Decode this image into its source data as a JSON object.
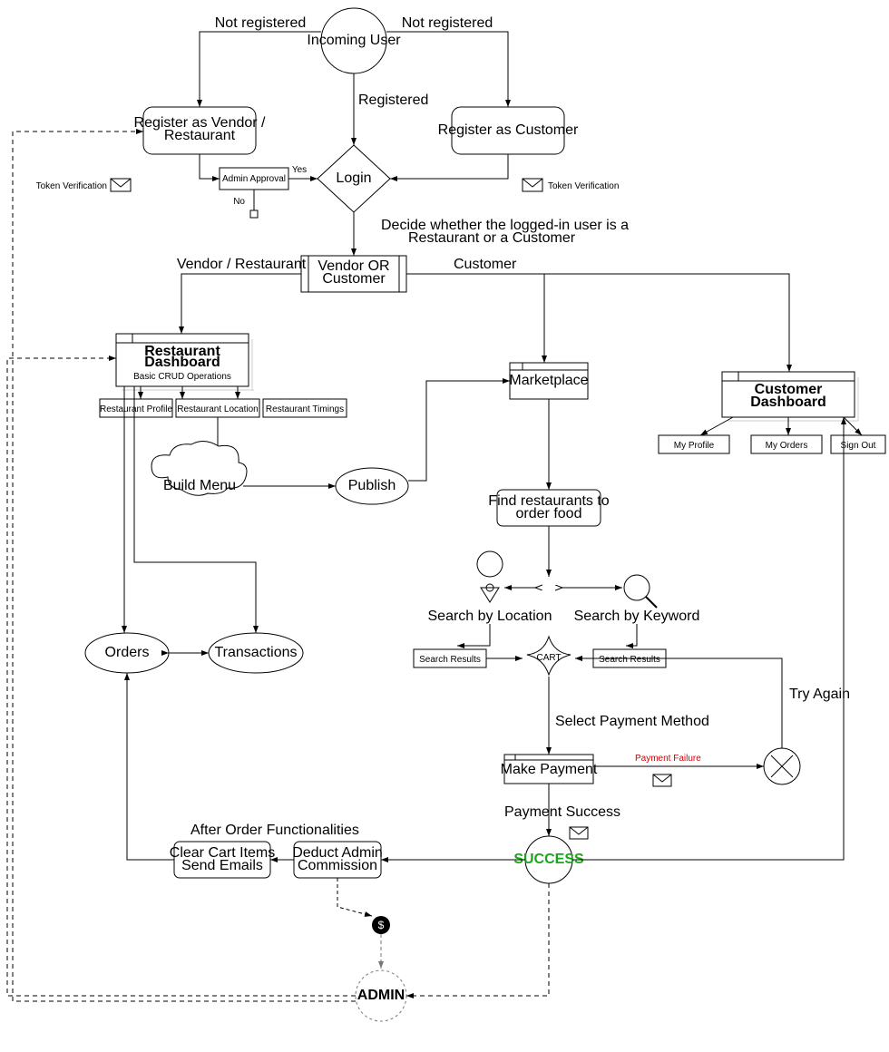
{
  "nodes": {
    "incoming": "Incoming User",
    "regVendorL1": "Register as Vendor /",
    "regVendorL2": "Restaurant",
    "regCustomer": "Register as Customer",
    "adminApproval": "Admin Approval",
    "login": "Login",
    "vendorOrCustL1": "Vendor OR",
    "vendorOrCustL2": "Customer",
    "restDashL1": "Restaurant",
    "restDashL2": "Dashboard",
    "restDashL3": "Basic CRUD Operations",
    "restProfile": "Restaurant Profile",
    "restLocation": "Restaurant Location",
    "restTimings": "Restaurant Timings",
    "buildMenu": "Build Menu",
    "publish": "Publish",
    "orders": "Orders",
    "transactions": "Transactions",
    "marketplace": "Marketplace",
    "findRestL1": "Find restaurants to",
    "findRestL2": "order food",
    "searchLoc": "Search by Location",
    "searchKey": "Search by Keyword",
    "searchResults": "Search Results",
    "cart": "CART",
    "makePayment": "Make Payment",
    "success": "SUCCESS",
    "clearCartL1": "Clear Cart Items",
    "clearCartL2": "Send Emails",
    "deductL1": "Deduct Admin",
    "deductL2": "Commission",
    "admin": "ADMIN",
    "custDashL1": "Customer",
    "custDashL2": "Dashboard",
    "myProfile": "My Profile",
    "myOrders": "My Orders",
    "signOut": "Sign Out"
  },
  "edges": {
    "notRegistered": "Not registered",
    "registered": "Registered",
    "yes": "Yes",
    "no": "No",
    "tokenVerif": "Token Verification",
    "decideL1": "Decide whether the logged-in user is a",
    "decideL2": "Restaurant or a Customer",
    "vendorRest": "Vendor / Restaurant",
    "customer": "Customer",
    "selectPayment": "Select Payment Method",
    "paymentFailure": "Payment Failure",
    "paymentSuccess": "Payment Success",
    "tryAgain": "Try Again",
    "afterOrder": "After Order Functionalities"
  }
}
